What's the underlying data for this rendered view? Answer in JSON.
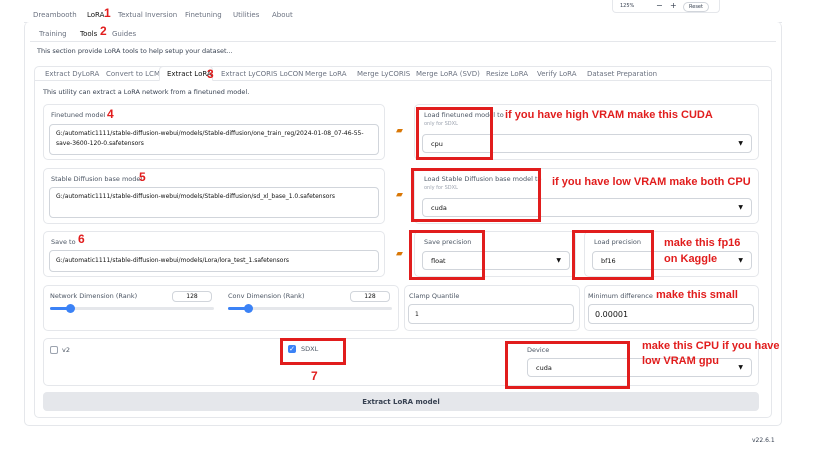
{
  "top_tabs": [
    "Dreambooth",
    "LoRA",
    "Textual Inversion",
    "Finetuning",
    "Utilities",
    "About"
  ],
  "sub_tabs": [
    "Training",
    "Tools",
    "Guides"
  ],
  "section_note": "This section provide LoRA tools to help setup your dataset...",
  "tool_tabs": [
    "Extract DyLoRA",
    "Convert to LCM",
    "Extract LoRA",
    "Extract LyCORIS LoCON",
    "Merge LoRA",
    "Merge LyCORIS",
    "Merge LoRA (SVD)",
    "Resize LoRA",
    "Verify LoRA",
    "Dataset Preparation"
  ],
  "utility_note": "This utility can extract a LoRA network from a finetuned model.",
  "zoom": {
    "value": "125%",
    "minus": "−",
    "plus": "+",
    "reset": "Reset"
  },
  "finetuned": {
    "label": "Finetuned model",
    "value": "G:/automatic1111/stable-diffusion-webui/models/Stable-diffusion/one_train_reg/2024-01-08_07-46-55-save-3600-120-0.safetensors",
    "load_label": "Load finetuned model to",
    "load_sub": "only for SDXL",
    "load_value": "cpu"
  },
  "base": {
    "label": "Stable Diffusion base model",
    "value": "G:/automatic1111/stable-diffusion-webui/models/Stable-diffusion/sd_xl_base_1.0.safetensors",
    "load_label": "Load Stable Diffusion base model to",
    "load_sub": "only for SDXL",
    "load_value": "cuda"
  },
  "save": {
    "label": "Save to",
    "value": "G:/automatic1111/stable-diffusion-webui/models/Lora/lora_test_1.safetensors",
    "precision_label": "Save precision",
    "precision_value": "float",
    "load_precision_label": "Load precision",
    "load_precision_value": "bf16"
  },
  "network_dim": {
    "label": "Network Dimension (Rank)",
    "value": "128",
    "fill": 0.12
  },
  "conv_dim": {
    "label": "Conv Dimension (Rank)",
    "value": "128",
    "fill": 0.12
  },
  "clamp": {
    "label": "Clamp Quantile",
    "value": "1"
  },
  "min_diff": {
    "label": "Minimum difference",
    "value": "0.00001"
  },
  "v2_label": "v2",
  "sdxl_label": "SDXL",
  "device": {
    "label": "Device",
    "value": "cuda"
  },
  "extract_button": "Extract LoRA model",
  "version": "v22.6.1",
  "annotations": {
    "n1": "1",
    "n2": "2",
    "n3": "3",
    "n4": "4",
    "n5": "5",
    "n6": "6",
    "n7": "7",
    "vram_high": "if you have high VRAM make this CUDA",
    "vram_low": "if you have low VRAM make both CPU",
    "fp16_line1": "make this fp16",
    "fp16_line2": "on Kaggle",
    "small": "make this small",
    "cpu_line1": "make this CPU if you have",
    "cpu_line2": "low VRAM gpu"
  },
  "colors": {
    "annotation_red": "#e11d1d",
    "accent_blue": "#3b82f6",
    "folder": "#d97706"
  }
}
